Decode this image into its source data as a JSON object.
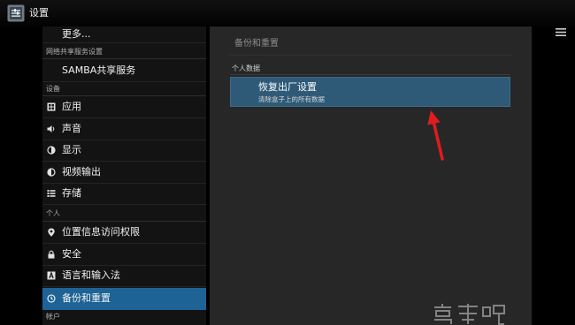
{
  "app": {
    "title": "设置",
    "icon": "settings-icon",
    "overflow_icon": "menu-icon"
  },
  "sidebar": {
    "groups": [
      {
        "items": [
          {
            "label": "更多..."
          }
        ]
      },
      {
        "header": "网络共享服务设置",
        "items": [
          {
            "label": "SAMBA共享服务"
          }
        ]
      },
      {
        "header": "设备",
        "items": [
          {
            "label": "应用",
            "icon": "apps-icon"
          },
          {
            "label": "声音",
            "icon": "speaker-icon"
          },
          {
            "label": "显示",
            "icon": "display-icon"
          },
          {
            "label": "视频输出",
            "icon": "video-output-icon"
          },
          {
            "label": "存储",
            "icon": "storage-icon"
          }
        ]
      },
      {
        "header": "个人",
        "items": [
          {
            "label": "位置信息访问权限",
            "icon": "location-icon"
          },
          {
            "label": "安全",
            "icon": "lock-icon"
          },
          {
            "label": "语言和输入法",
            "icon": "language-icon"
          },
          {
            "label": "备份和重置",
            "icon": "backup-icon",
            "selected": true
          }
        ]
      },
      {
        "header": "帐户",
        "items": []
      }
    ]
  },
  "detail": {
    "title": "备份和重置",
    "sections": [
      {
        "header": "个人数据",
        "items": [
          {
            "title": "恢复出厂设置",
            "summary": "清除盒子上的所有数据",
            "focused": true
          }
        ]
      }
    ]
  },
  "colors": {
    "selected_bg": "#1d6395",
    "focused_bg": "#2e5a77",
    "annotation_arrow": "#e01c1c"
  }
}
